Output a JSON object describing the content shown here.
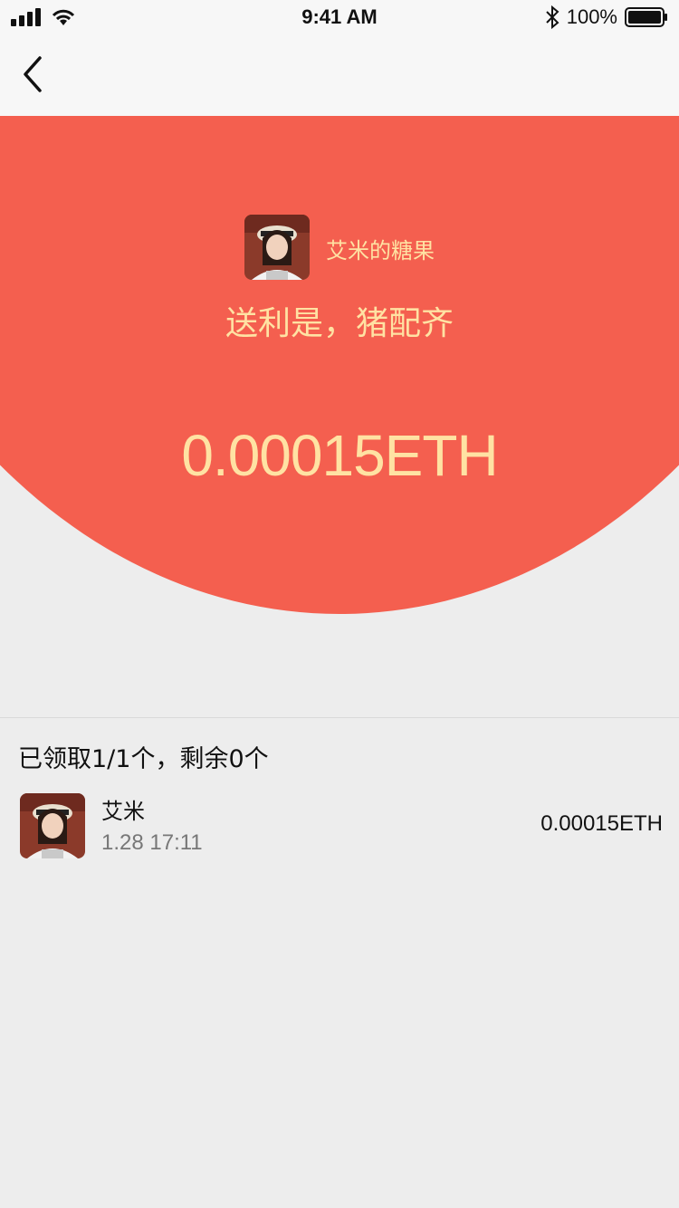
{
  "status_bar": {
    "time": "9:41 AM",
    "battery": "100%",
    "icons": [
      "signal-icon",
      "wifi-icon",
      "bluetooth-icon",
      "battery-icon"
    ]
  },
  "nav": {
    "back_icon": "chevron-left-icon"
  },
  "packet": {
    "sender_name": "艾米的糖果",
    "greeting": "送利是，猪配齐",
    "amount": "0.00015ETH"
  },
  "claims": {
    "summary": "已领取1/1个，剩余0个",
    "records": [
      {
        "name": "艾米",
        "time": "1.28  17:11",
        "amount": "0.00015ETH"
      }
    ]
  },
  "colors": {
    "header_red": "#f45f4f",
    "gold_text": "#ffe2a3",
    "background": "#ededed"
  }
}
